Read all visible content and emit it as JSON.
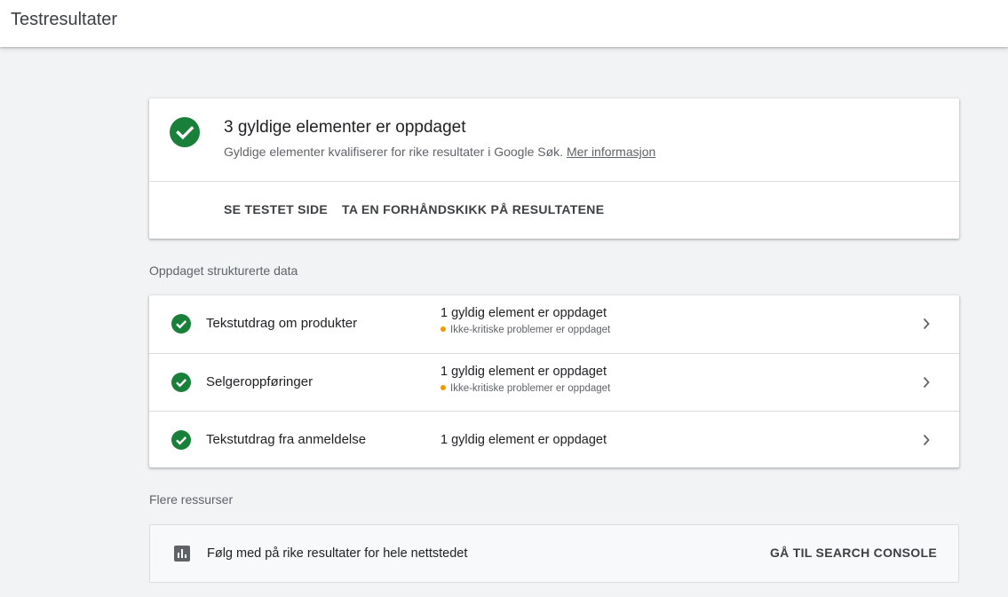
{
  "header": {
    "title": "Testresultater"
  },
  "summary": {
    "title": "3 gyldige elementer er oppdaget",
    "description": "Gyldige elementer kvalifiserer for rike resultater i Google Søk.",
    "learn_more": "Mer informasjon",
    "actions": [
      "SE TESTET SIDE",
      "TA EN FORHÅNDSKIKK PÅ RESULTATENE"
    ]
  },
  "detected": {
    "section_label": "Oppdaget strukturerte data",
    "items": [
      {
        "name": "Tekstutdrag om produkter",
        "status": "1 gyldig element er oppdaget",
        "warning": "Ikke-kritiske problemer er oppdaget"
      },
      {
        "name": "Selgeroppføringer",
        "status": "1 gyldig element er oppdaget",
        "warning": "Ikke-kritiske problemer er oppdaget"
      },
      {
        "name": "Tekstutdrag fra anmeldelse",
        "status": "1 gyldig element er oppdaget",
        "warning": ""
      }
    ]
  },
  "resources": {
    "section_label": "Flere ressurser",
    "text": "Følg med på rike resultater for hele nettstedet",
    "link": "GÅ TIL SEARCH CONSOLE"
  },
  "icons": {
    "valid": "check-circle-icon",
    "row_arrow": "chevron-right-icon",
    "resource": "bar-chart-icon",
    "warning": "warning-dot-icon"
  },
  "colors": {
    "valid_green": "#188038",
    "warning_orange": "#f29900",
    "background": "#f1f3f4",
    "card": "#ffffff"
  }
}
